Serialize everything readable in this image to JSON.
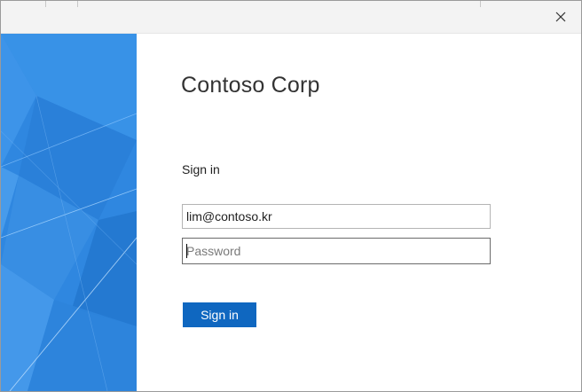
{
  "window": {
    "close_icon": "close-icon"
  },
  "branding": {
    "org_name": "Contoso Corp",
    "panel_color": "#2f87e0"
  },
  "form": {
    "heading": "Sign in",
    "email_value": "lim@contoso.kr",
    "password_placeholder": "Password",
    "submit_label": "Sign in",
    "submit_color": "#0f67c0"
  }
}
